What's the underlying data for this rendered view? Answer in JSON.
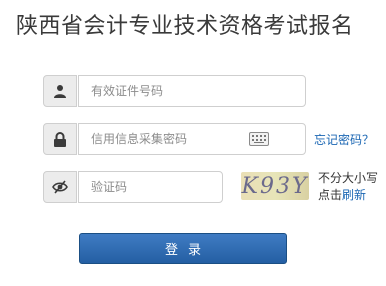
{
  "title": "陕西省会计专业技术资格考试报名",
  "fields": {
    "id_number": {
      "placeholder": "有效证件号码",
      "icon": "user-icon"
    },
    "password": {
      "placeholder": "信用信息采集密码",
      "icon": "lock-icon",
      "aux_icon": "keyboard-icon"
    },
    "captcha": {
      "placeholder": "验证码",
      "icon": "eye-icon"
    }
  },
  "forgot_password": "忘记密码？",
  "captcha_image_text": "K93Y",
  "case_note": "不分大小写",
  "click_text": "点击",
  "refresh_text": "刷新",
  "login_label": "登录",
  "colors": {
    "primary": "#245fa3",
    "link": "#1a66b3"
  }
}
